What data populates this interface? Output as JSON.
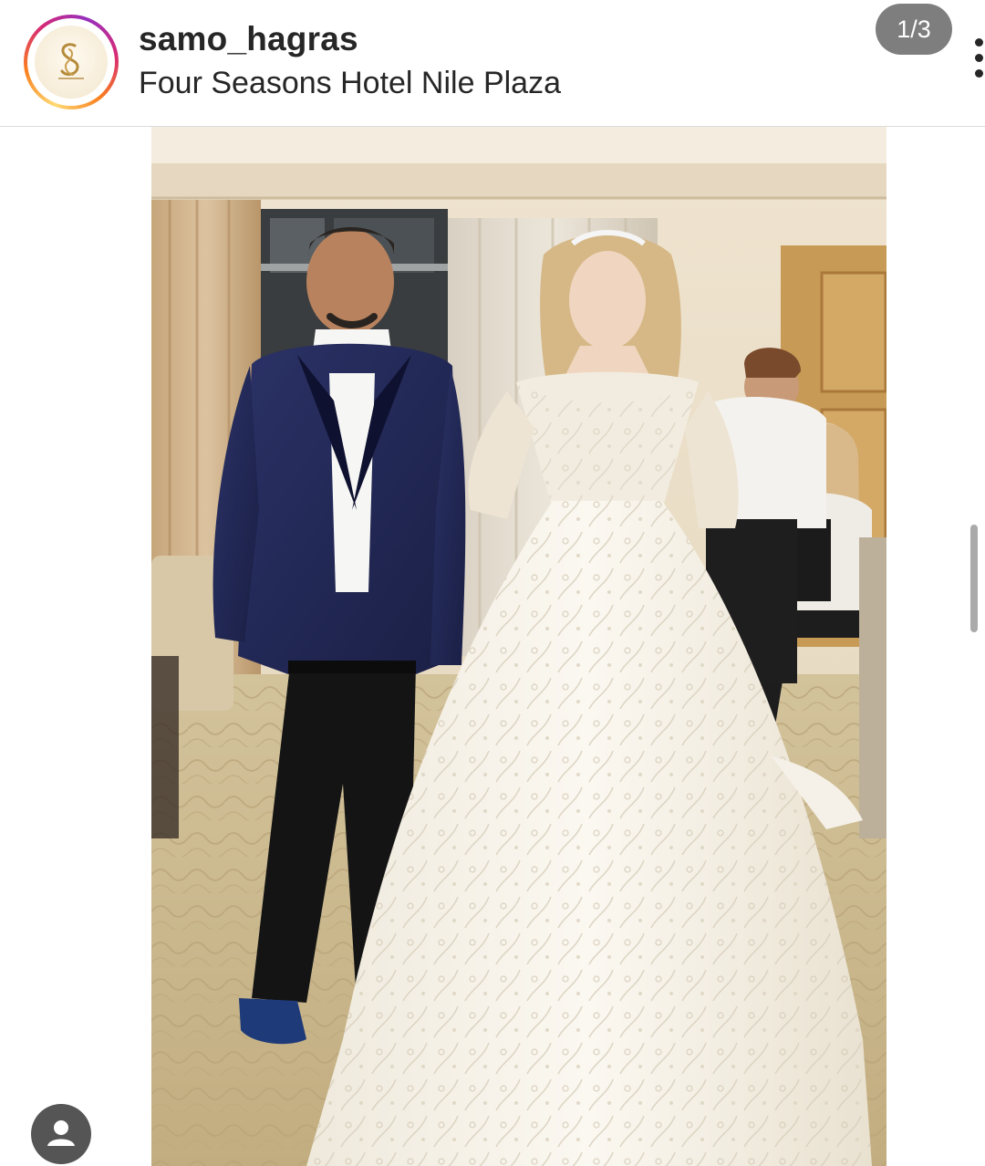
{
  "post": {
    "username": "samo_hagras",
    "location": "Four Seasons Hotel Nile Plaza",
    "carousel_counter": "1/3",
    "media_description": "photo"
  },
  "icons": {
    "avatar": "salon-logo-avatar",
    "more": "more-vertical-icon",
    "tagged_users": "user-tag-icon"
  },
  "colors": {
    "story_ring": [
      "#feda75",
      "#fa7e1e",
      "#d62976",
      "#962fbf"
    ],
    "text": "#262626",
    "badge": "#5a5a5a"
  }
}
